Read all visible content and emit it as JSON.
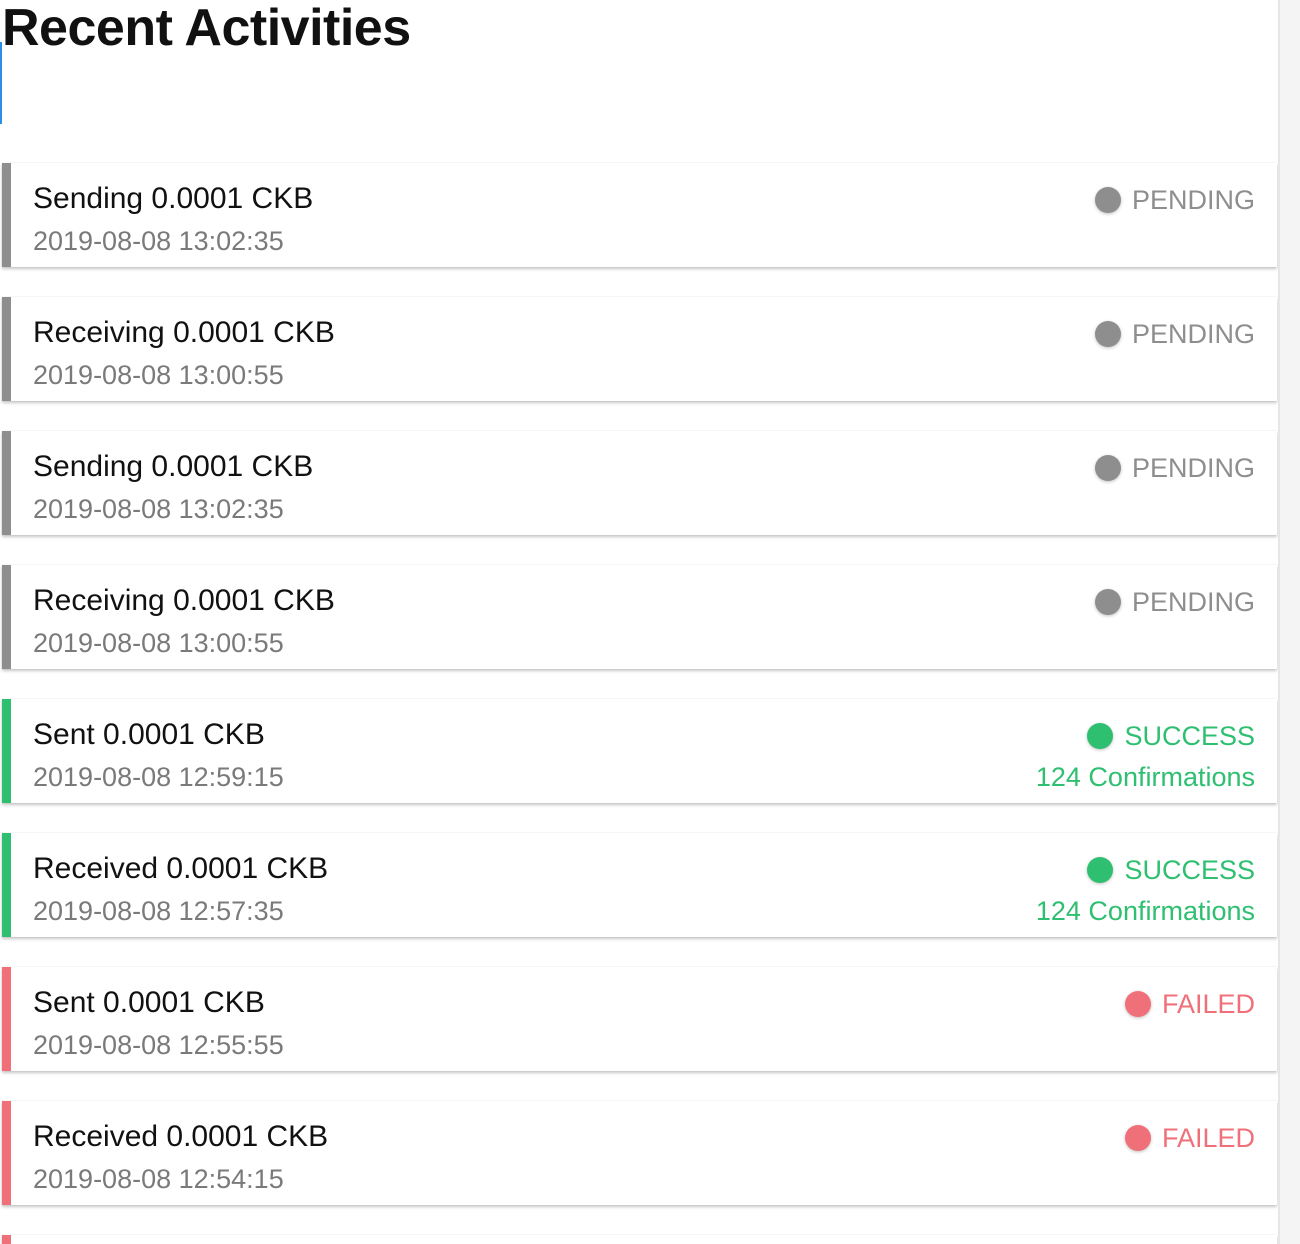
{
  "page": {
    "title": "Recent Activities"
  },
  "colors": {
    "pending": "#8e8e8e",
    "success": "#2fbf71",
    "failed": "#f0707a",
    "focus_accent": "#2b8fe8"
  },
  "activities": [
    {
      "title": "Sending 0.0001 CKB",
      "time": "2019-08-08 13:02:35",
      "status": "pending",
      "status_label": "PENDING",
      "confirmations": ""
    },
    {
      "title": "Receiving 0.0001 CKB",
      "time": "2019-08-08 13:00:55",
      "status": "pending",
      "status_label": "PENDING",
      "confirmations": ""
    },
    {
      "title": "Sending 0.0001 CKB",
      "time": "2019-08-08 13:02:35",
      "status": "pending",
      "status_label": "PENDING",
      "confirmations": ""
    },
    {
      "title": "Receiving 0.0001 CKB",
      "time": "2019-08-08 13:00:55",
      "status": "pending",
      "status_label": "PENDING",
      "confirmations": ""
    },
    {
      "title": "Sent 0.0001 CKB",
      "time": "2019-08-08 12:59:15",
      "status": "success",
      "status_label": "SUCCESS",
      "confirmations": "124 Confirmations"
    },
    {
      "title": "Received 0.0001 CKB",
      "time": "2019-08-08 12:57:35",
      "status": "success",
      "status_label": "SUCCESS",
      "confirmations": "124 Confirmations"
    },
    {
      "title": "Sent 0.0001 CKB",
      "time": "2019-08-08 12:55:55",
      "status": "failed",
      "status_label": "FAILED",
      "confirmations": ""
    },
    {
      "title": "Received 0.0001 CKB",
      "time": "2019-08-08 12:54:15",
      "status": "failed",
      "status_label": "FAILED",
      "confirmations": ""
    }
  ],
  "partial_card_status": "failed"
}
